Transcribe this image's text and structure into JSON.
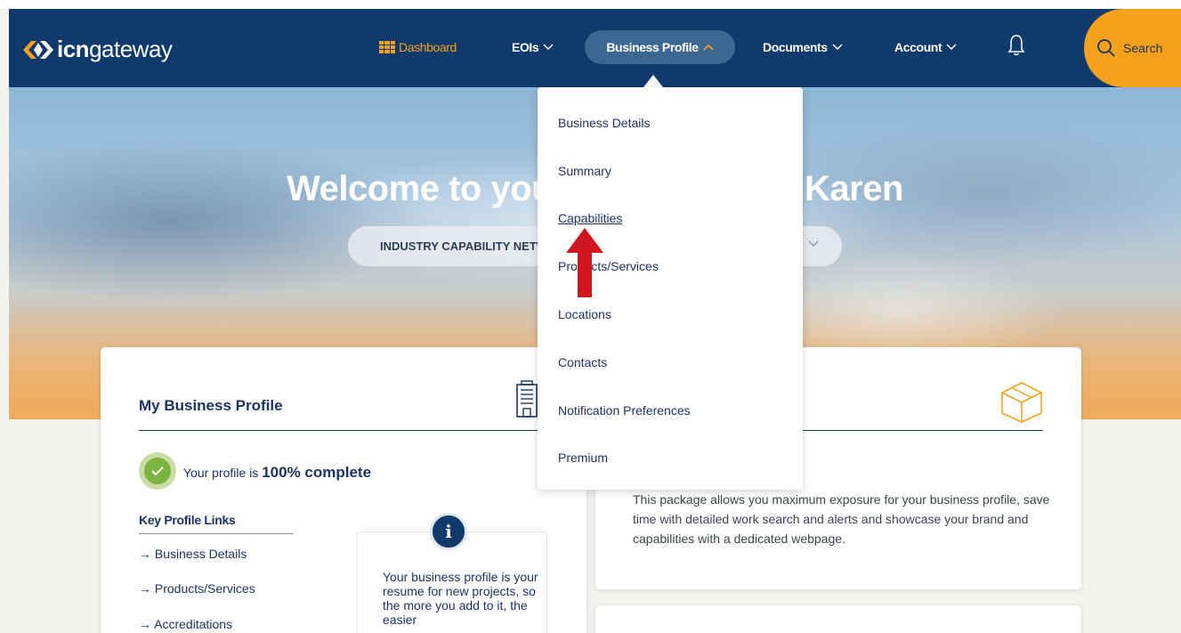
{
  "brand": {
    "logo_bold": "icn",
    "logo_light": "gateway"
  },
  "nav": {
    "dashboard": "Dashboard",
    "eois": "EOIs",
    "business_profile": "Business Profile",
    "documents": "Documents",
    "account": "Account",
    "search": "Search"
  },
  "hero": {
    "title": "Welcome to your ICN Gateway, Karen",
    "select_value": "INDUSTRY CAPABILITY NETWORK"
  },
  "dropdown": {
    "items": [
      {
        "label": "Business Details"
      },
      {
        "label": "Summary"
      },
      {
        "label": "Capabilities"
      },
      {
        "label": "Products/Services"
      },
      {
        "label": "Locations"
      },
      {
        "label": "Contacts"
      },
      {
        "label": "Notification Preferences"
      },
      {
        "label": "Premium"
      }
    ]
  },
  "profile_card": {
    "title": "My Business Profile",
    "progress_prefix": "Your profile is ",
    "progress_value": "100% complete",
    "key_links_title": "Key Profile Links",
    "links": [
      {
        "label": "→ Business Details"
      },
      {
        "label": "→ Products/Services"
      },
      {
        "label": "→ Accreditations"
      }
    ],
    "info_text": "Your business profile is your resume for new projects, so the more you add to it, the easier"
  },
  "premium_card": {
    "description": "This package allows you maximum exposure for your business profile, save time with detailed work search and alerts and showcase your brand and capabilities with a dedicated webpage."
  },
  "colors": {
    "nav_bg": "#0f3a6b",
    "accent_orange": "#f5a11c",
    "nav_active_pill": "#3b6791",
    "text_navy": "#1c3463",
    "check_green": "#7cb342",
    "annotation_red": "#d0161e"
  }
}
